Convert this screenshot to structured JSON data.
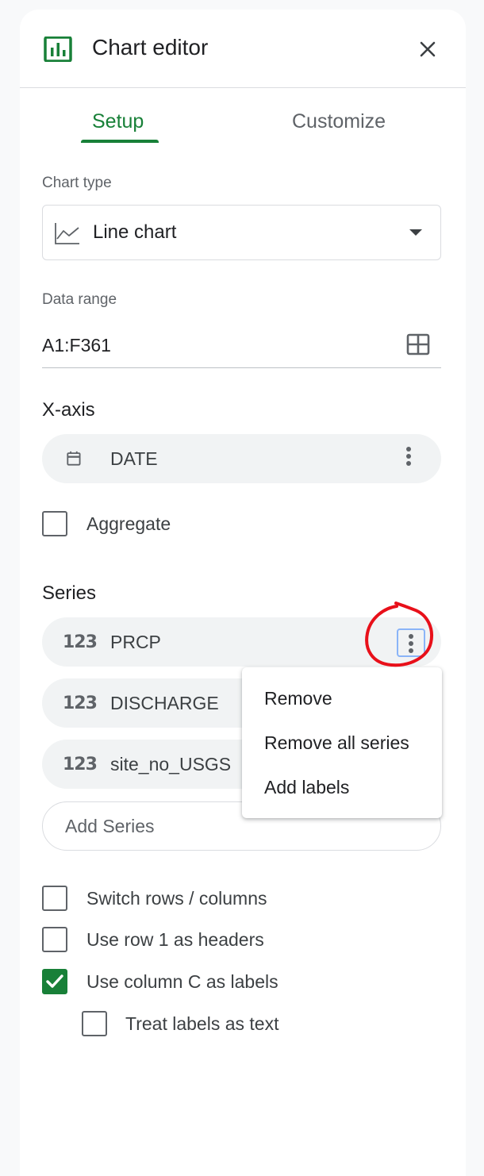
{
  "header": {
    "title": "Chart editor",
    "icon": "bar-chart-icon",
    "close_icon": "close-icon"
  },
  "tabs": [
    {
      "label": "Setup",
      "active": true
    },
    {
      "label": "Customize",
      "active": false
    }
  ],
  "chart_type": {
    "label": "Chart type",
    "value": "Line chart",
    "icon": "line-chart-icon"
  },
  "data_range": {
    "label": "Data range",
    "value": "A1:F361",
    "icon": "select-range-icon"
  },
  "x_axis": {
    "title": "X-axis",
    "chip": {
      "label": "DATE",
      "icon": "calendar-icon"
    },
    "aggregate_label": "Aggregate",
    "aggregate_checked": false
  },
  "series": {
    "title": "Series",
    "items": [
      {
        "label": "PRCP",
        "icon": "123"
      },
      {
        "label": "DISCHARGE",
        "icon": "123"
      },
      {
        "label": "site_no_USGS",
        "icon": "123"
      }
    ],
    "add_label": "Add Series"
  },
  "context_menu": {
    "items": [
      "Remove",
      "Remove all series",
      "Add labels"
    ]
  },
  "options": [
    {
      "label": "Switch rows / columns",
      "checked": false
    },
    {
      "label": "Use row 1 as headers",
      "checked": false
    },
    {
      "label": "Use column C as labels",
      "checked": true
    },
    {
      "label": "Treat labels as text",
      "checked": false
    }
  ],
  "colors": {
    "accent": "#188038",
    "annotation": "#e8101a",
    "focus": "#8ab4f8"
  }
}
